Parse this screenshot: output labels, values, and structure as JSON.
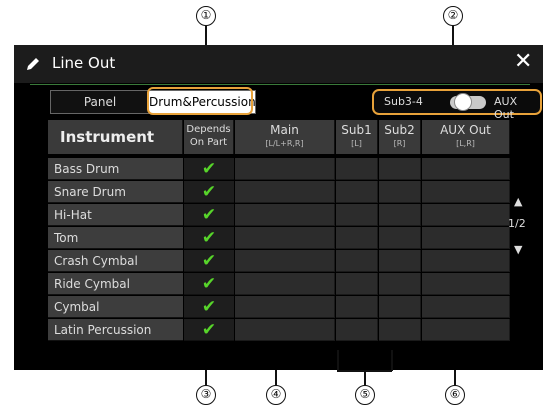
{
  "window": {
    "title": "Line Out"
  },
  "tabs": [
    {
      "label": "Panel",
      "selected": false
    },
    {
      "label": "Drum&Percussion",
      "selected": true
    }
  ],
  "aux_toggle": {
    "left_label": "Sub3-4",
    "right_label": "AUX Out",
    "state": "AUX Out"
  },
  "table": {
    "headers": {
      "instrument": "Instrument",
      "depends": [
        "Depends",
        "On Part"
      ],
      "main": [
        "Main",
        "[L/L+R,R]"
      ],
      "sub1": [
        "Sub1",
        "[L]"
      ],
      "sub2": [
        "Sub2",
        "[R]"
      ],
      "aux": [
        "AUX Out",
        "[L,R]"
      ]
    },
    "rows": [
      {
        "name": "Bass Drum",
        "depends_on_part": true
      },
      {
        "name": "Snare Drum",
        "depends_on_part": true
      },
      {
        "name": "Hi-Hat",
        "depends_on_part": true
      },
      {
        "name": "Tom",
        "depends_on_part": true
      },
      {
        "name": "Crash Cymbal",
        "depends_on_part": true
      },
      {
        "name": "Ride Cymbal",
        "depends_on_part": true
      },
      {
        "name": "Cymbal",
        "depends_on_part": true
      },
      {
        "name": "Latin Percussion",
        "depends_on_part": true
      }
    ]
  },
  "pager": {
    "label": "1/2",
    "up_glyph": "▲",
    "down_glyph": "▼"
  },
  "callouts": [
    "①",
    "②",
    "③",
    "④",
    "⑤",
    "⑥"
  ],
  "colors": {
    "check": "#57d42a",
    "highlight": "#e8a23a"
  }
}
